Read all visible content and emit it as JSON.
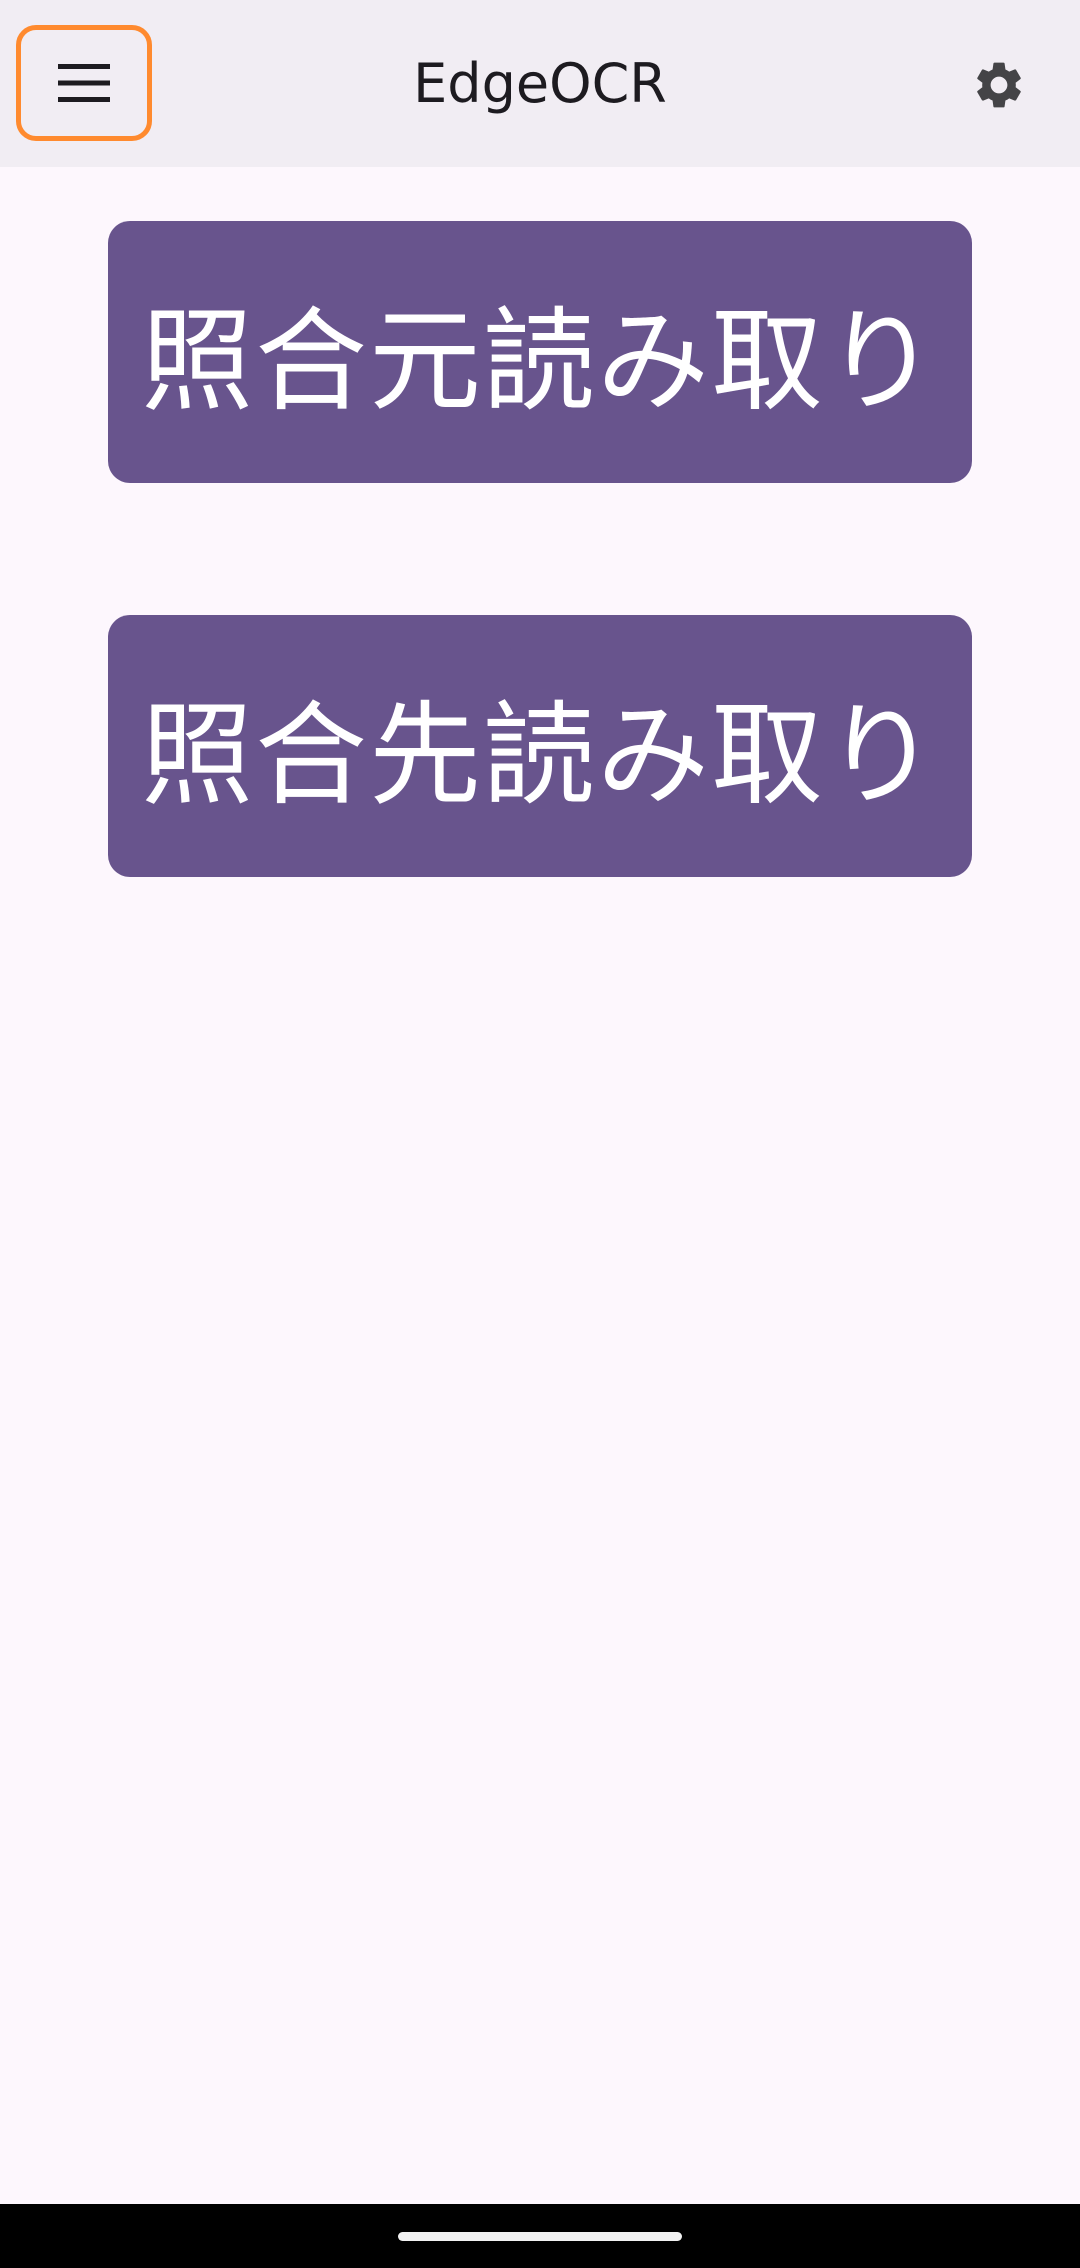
{
  "app_bar": {
    "title": "EdgeOCR",
    "menu_icon": "hamburger-menu-icon",
    "settings_icon": "gear-icon",
    "background": "#f1edf3",
    "highlight_color": "#ff8a2e"
  },
  "main": {
    "buttons": [
      {
        "label": "照合元読み取り"
      },
      {
        "label": "照合先読み取り"
      }
    ],
    "button_color": "#68548d",
    "background": "#fdf7fd"
  },
  "system_nav": {
    "home_indicator": "home-indicator"
  }
}
